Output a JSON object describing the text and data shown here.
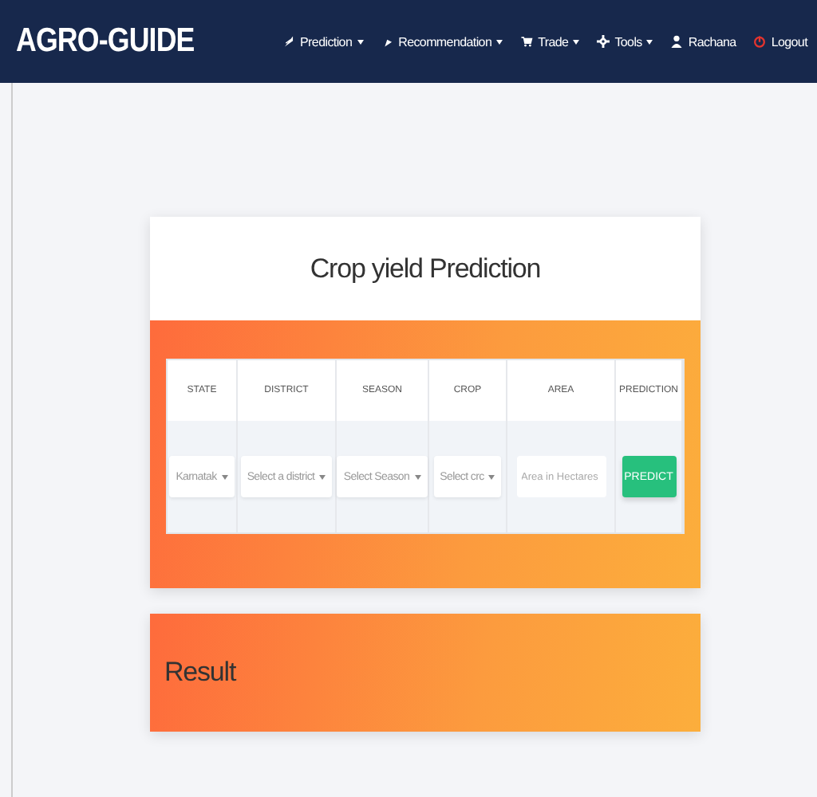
{
  "navbar": {
    "brand": "AGRO-GUIDE",
    "items": [
      {
        "label": "Prediction",
        "dropdown": true
      },
      {
        "label": "Recommendation",
        "dropdown": true
      },
      {
        "label": "Trade",
        "dropdown": true
      },
      {
        "label": "Tools",
        "dropdown": true
      },
      {
        "label": "Rachana",
        "dropdown": false
      },
      {
        "label": "Logout",
        "dropdown": false
      }
    ]
  },
  "form_card": {
    "title": "Crop yield Prediction",
    "columns": [
      "STATE",
      "DISTRICT",
      "SEASON",
      "CROP",
      "AREA",
      "PREDICTION"
    ],
    "fields": [
      {
        "kind": "select",
        "value": "Karnatak"
      },
      {
        "kind": "select",
        "placeholder": "Select a district"
      },
      {
        "kind": "select",
        "placeholder": "Select Season"
      },
      {
        "kind": "select",
        "placeholder": "Select crc"
      },
      {
        "kind": "input",
        "placeholder": "Area in Hectares"
      },
      {
        "kind": "button",
        "label": "PREDICT"
      }
    ]
  },
  "result_card": {
    "title": "Result"
  }
}
